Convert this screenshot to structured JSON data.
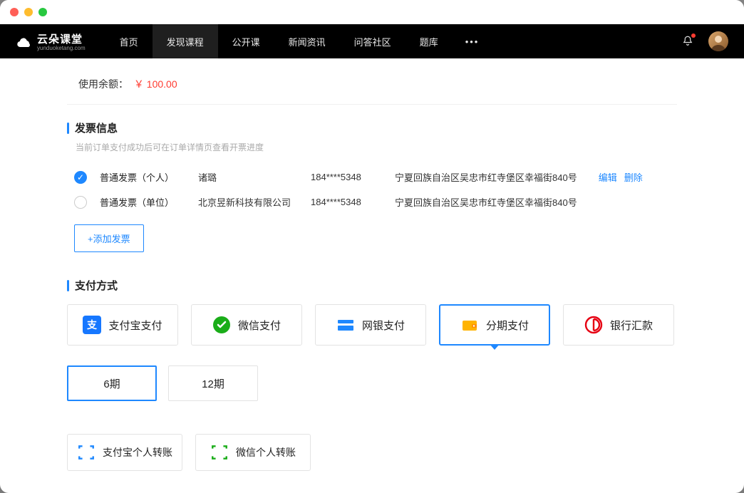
{
  "nav": {
    "brand": "云朵课堂",
    "brand_sub": "yunduoketang.com",
    "items": [
      "首页",
      "发现课程",
      "公开课",
      "新闻资讯",
      "问答社区",
      "题库"
    ],
    "active_index": 1,
    "more": "•••"
  },
  "balance": {
    "label": "使用余额：",
    "amount": "￥ 100.00"
  },
  "invoice": {
    "section_title": "发票信息",
    "subtitle": "当前订单支付成功后可在订单详情页查看开票进度",
    "rows": [
      {
        "type": "普通发票（个人）",
        "name": "诸璐",
        "phone": "184****5348",
        "addr": "宁夏回族自治区吴忠市红寺堡区幸福街840号",
        "selected": true,
        "actions": [
          "编辑",
          "删除"
        ]
      },
      {
        "type": "普通发票（单位）",
        "name": "北京昱新科技有限公司",
        "phone": "184****5348",
        "addr": "宁夏回族自治区吴忠市红寺堡区幸福街840号",
        "selected": false
      }
    ],
    "add_label": "+添加发票"
  },
  "payment": {
    "section_title": "支付方式",
    "methods": [
      {
        "label": "支付宝支付",
        "icon": "alipay"
      },
      {
        "label": "微信支付",
        "icon": "wechat"
      },
      {
        "label": "网银支付",
        "icon": "unionpay"
      },
      {
        "label": "分期支付",
        "icon": "wallet",
        "selected": true
      },
      {
        "label": "银行汇款",
        "icon": "bank"
      }
    ],
    "periods": [
      {
        "label": "6期",
        "selected": true
      },
      {
        "label": "12期",
        "selected": false
      }
    ],
    "transfers": [
      {
        "label": "支付宝个人转账",
        "icon": "scan-blue"
      },
      {
        "label": "微信个人转账",
        "icon": "scan-green"
      }
    ]
  }
}
